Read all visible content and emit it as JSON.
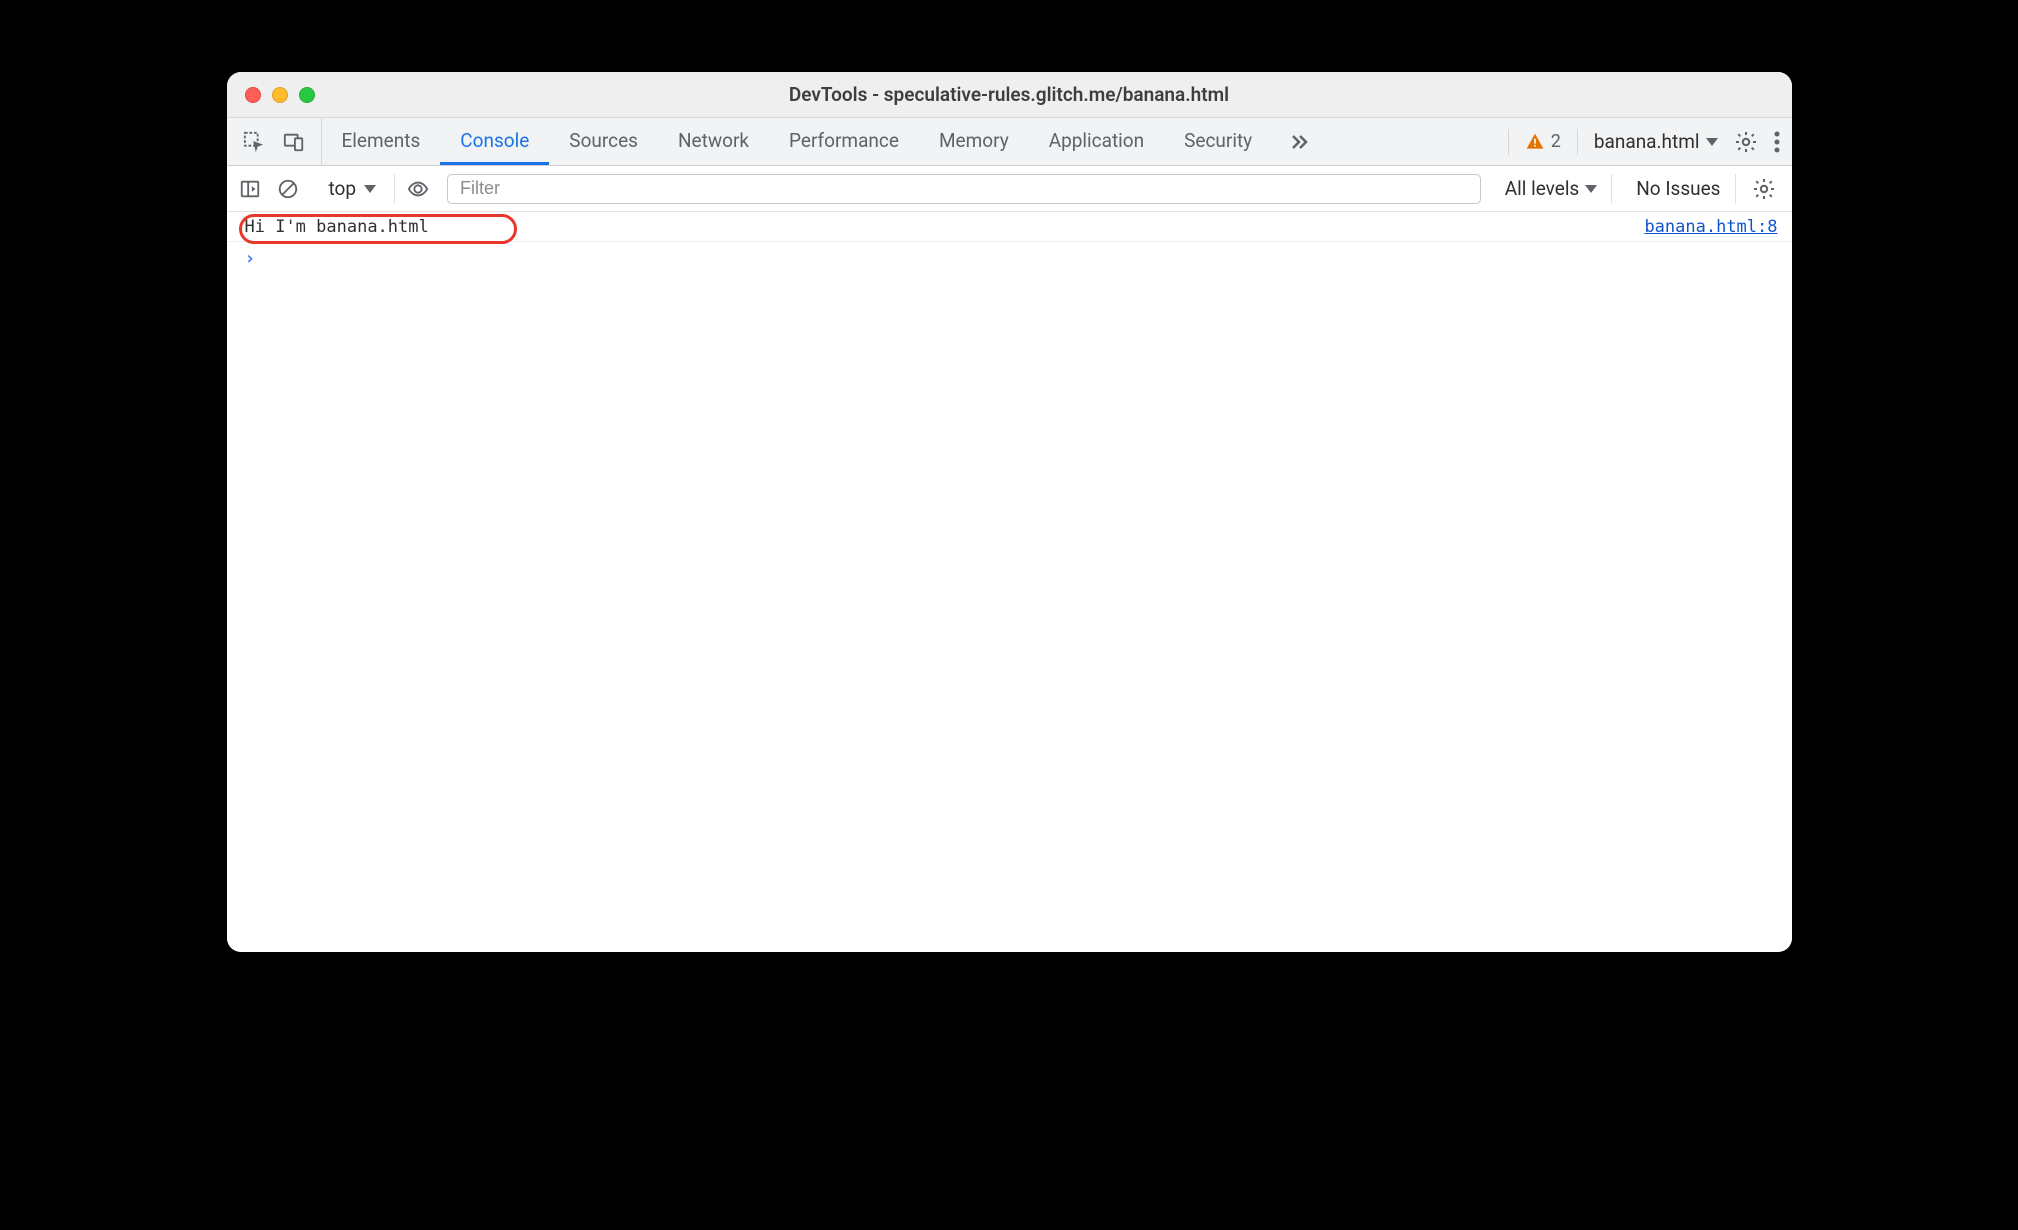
{
  "titlebar": {
    "title": "DevTools - speculative-rules.glitch.me/banana.html"
  },
  "tabs": {
    "panels": [
      "Elements",
      "Console",
      "Sources",
      "Network",
      "Performance",
      "Memory",
      "Application",
      "Security"
    ],
    "active_index": 1,
    "warning_count": "2",
    "frame_selector": "banana.html"
  },
  "console_toolbar": {
    "context": "top",
    "filter_placeholder": "Filter",
    "levels_label": "All levels",
    "issues_label": "No Issues"
  },
  "console": {
    "logs": [
      {
        "message": "Hi I'm banana.html",
        "source": "banana.html:8"
      }
    ]
  }
}
